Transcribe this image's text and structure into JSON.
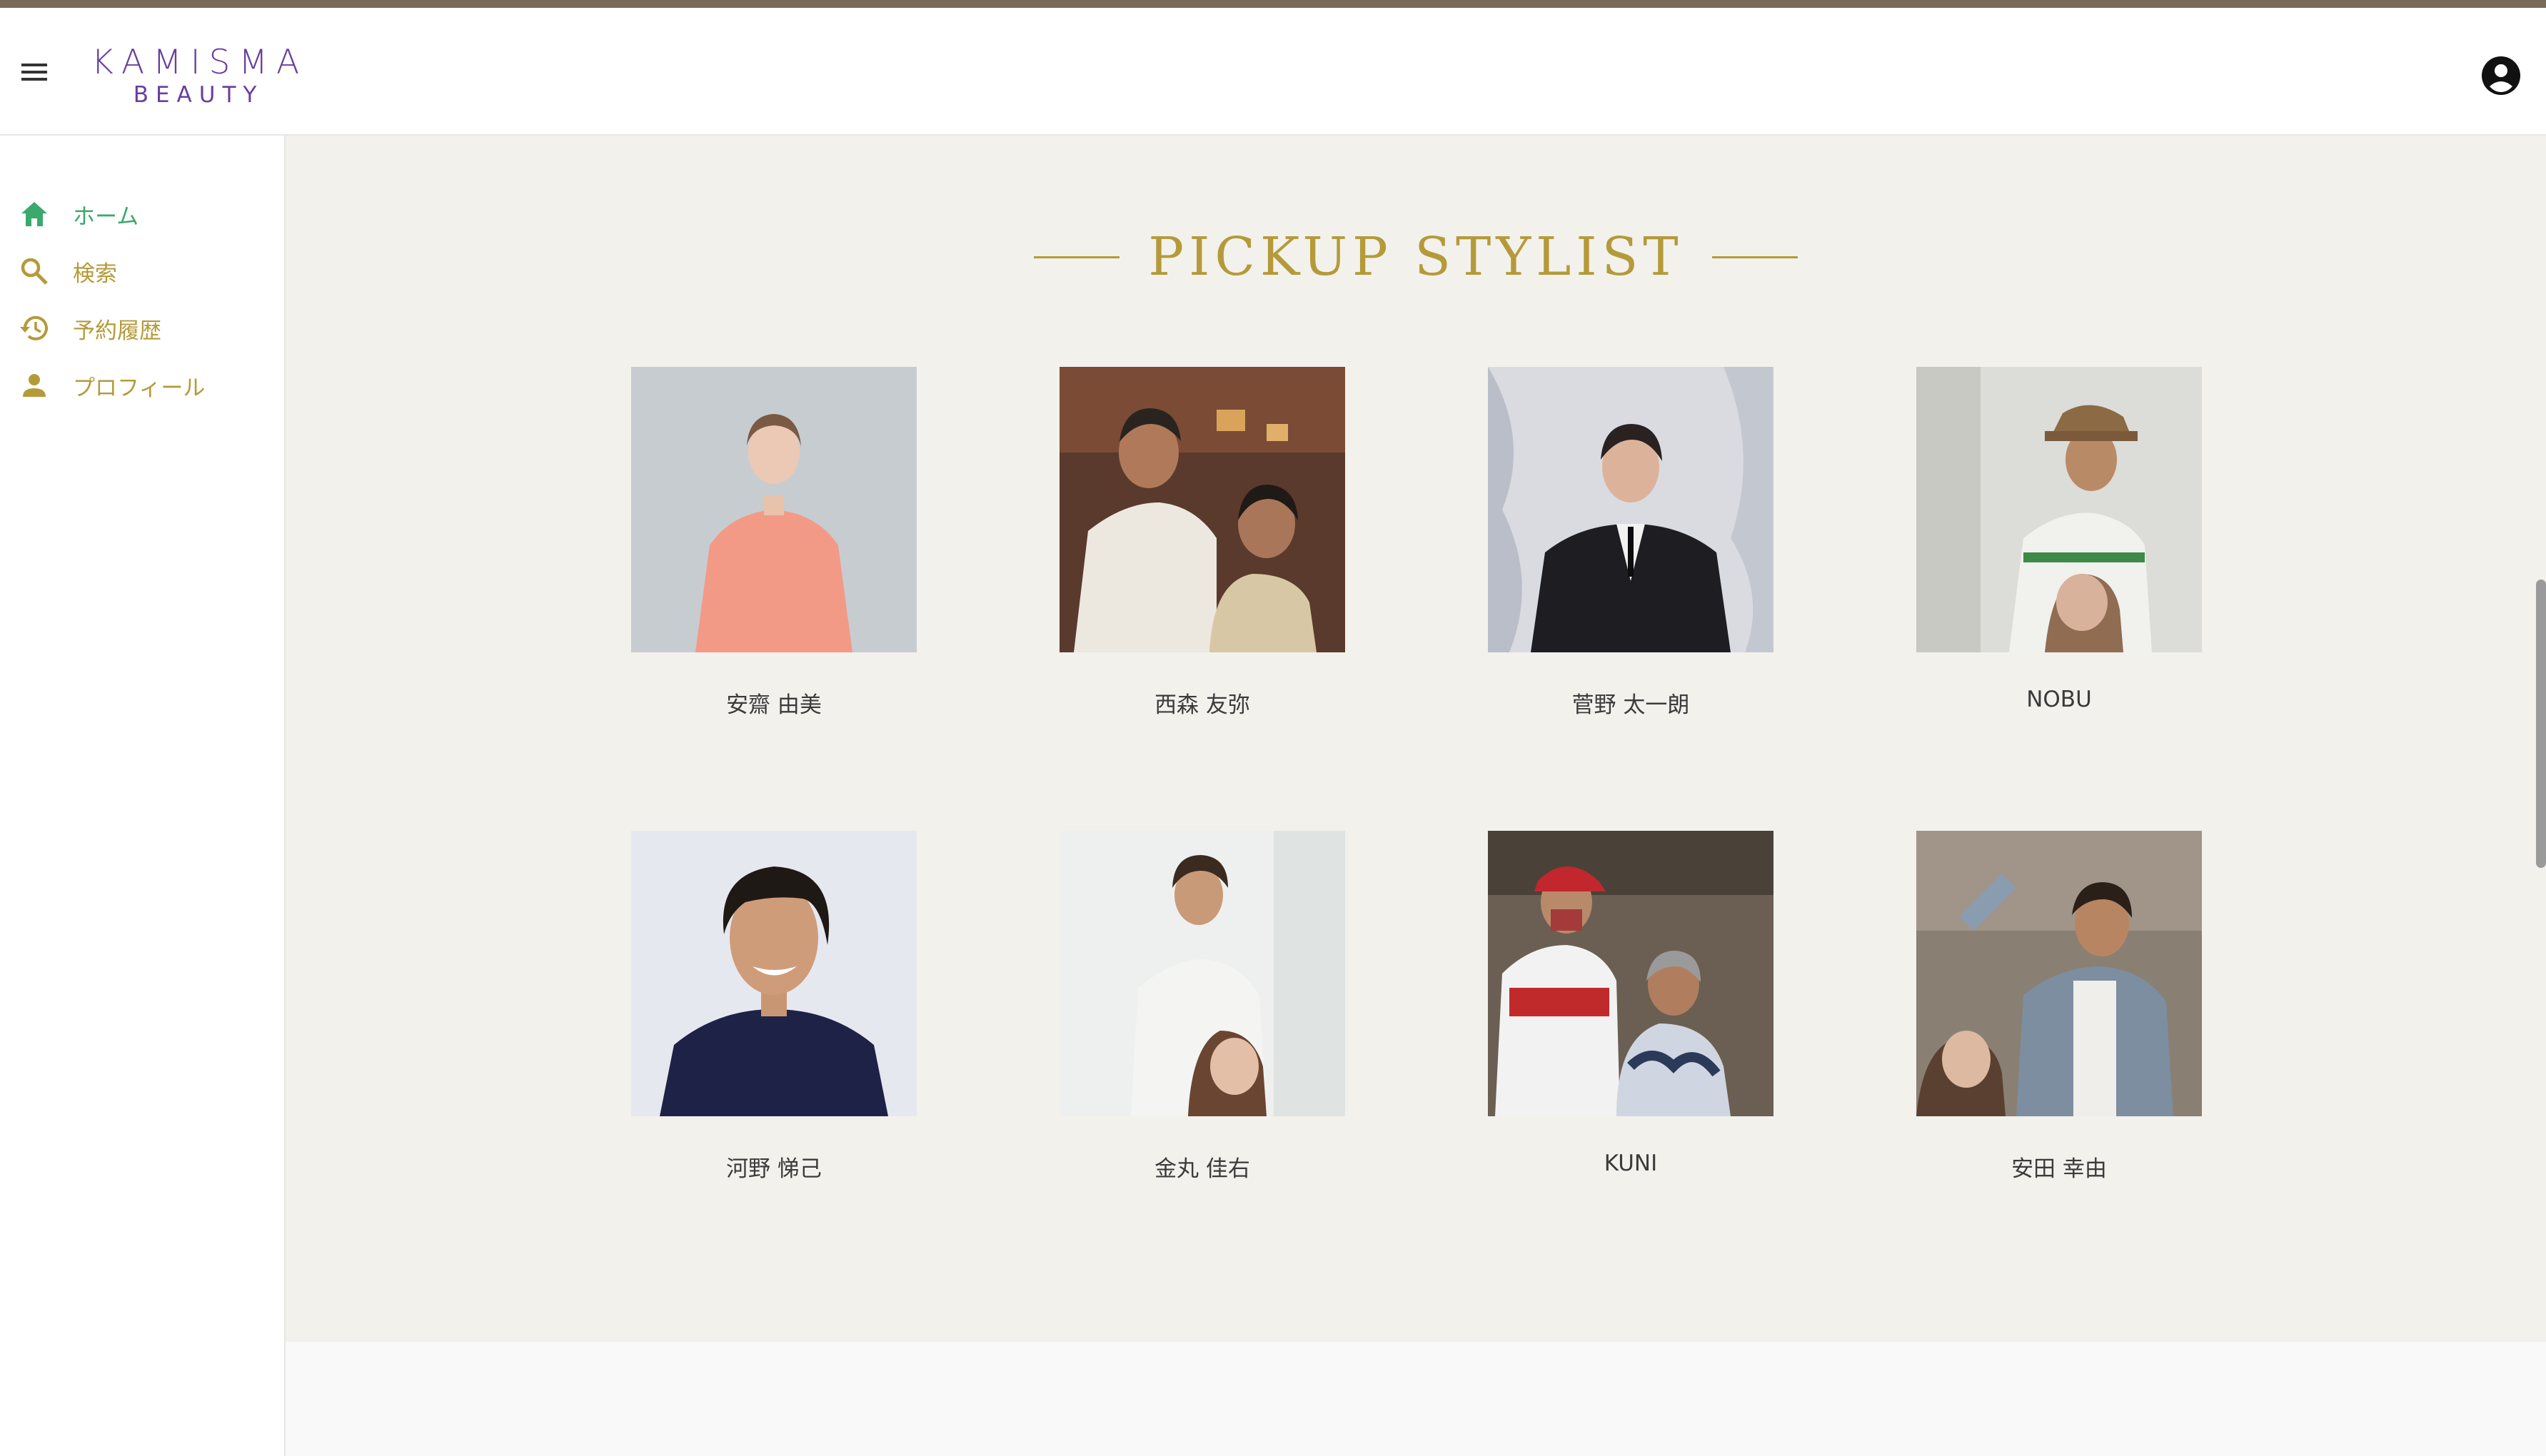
{
  "header": {
    "logo_line1": "KAMISMA",
    "logo_line2": "BEAUTY"
  },
  "sidebar": {
    "items": [
      {
        "label": "ホーム",
        "icon": "home-icon",
        "active": true
      },
      {
        "label": "検索",
        "icon": "search-icon",
        "active": false
      },
      {
        "label": "予約履歴",
        "icon": "history-icon",
        "active": false
      },
      {
        "label": "プロフィール",
        "icon": "person-icon",
        "active": false
      }
    ]
  },
  "main": {
    "section_title": "PICKUP STYLIST",
    "stylists": [
      {
        "name": "安齋 由美"
      },
      {
        "name": "西森 友弥"
      },
      {
        "name": "菅野 太一朗"
      },
      {
        "name": "NOBU"
      },
      {
        "name": "河野 悌己"
      },
      {
        "name": "金丸 佳右"
      },
      {
        "name": "KUNI"
      },
      {
        "name": "安田 幸由"
      }
    ]
  },
  "colors": {
    "accent_gold": "#b59a3a",
    "active_green": "#3aa96b",
    "brand_purple": "#6a3f9e",
    "top_strip": "#7a6a59",
    "main_bg": "#f2f1ec"
  }
}
